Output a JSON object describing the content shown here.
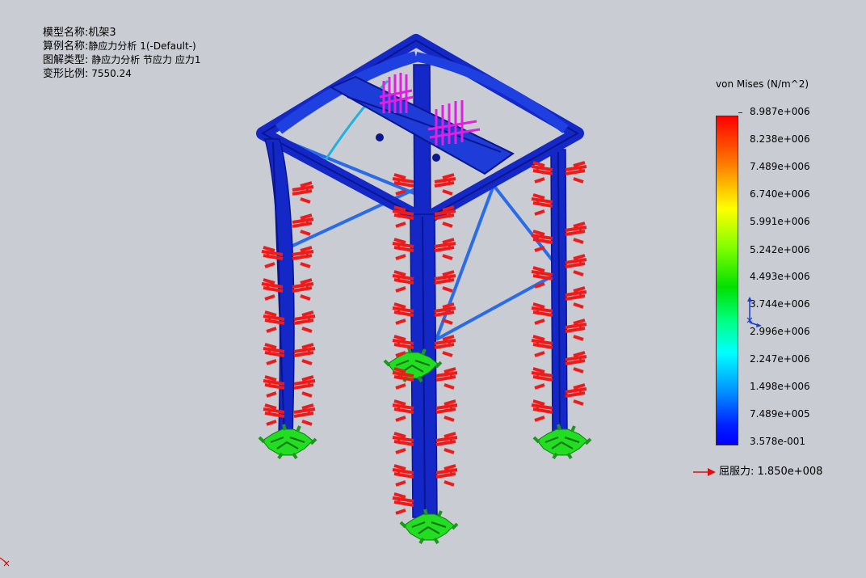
{
  "info": {
    "model_label": "模型名称:",
    "model_value": "机架3",
    "study_label": "算例名称:",
    "study_value": "静应力分析 1(-Default-)",
    "plot_label": "图解类型:",
    "plot_value": "静应力分析 节应力 应力1",
    "scale_label": "变形比例:",
    "scale_value": "7550.24"
  },
  "legend": {
    "title": "von Mises (N/m^2)",
    "ticks": [
      "8.987e+006",
      "8.238e+006",
      "7.489e+006",
      "6.740e+006",
      "5.991e+006",
      "5.242e+006",
      "4.493e+006",
      "3.744e+006",
      "2.996e+006",
      "2.247e+006",
      "1.498e+006",
      "7.489e+005",
      "3.578e-001"
    ],
    "yield_label": "屈服力:",
    "yield_value": "1.850e+008"
  },
  "colors": {
    "frame": "#1428c8",
    "frame_dark": "#0a1590",
    "brace": "#2a6ce8",
    "force": "#ee1b1b",
    "fixture": "#22dd22",
    "load": "#e020e0",
    "background": "#c9ccd3"
  },
  "icons": {
    "triad": "coordinate-triad-icon",
    "corner_axis": "corner-axis-icon",
    "yield_arrow": "red-arrow-icon"
  }
}
